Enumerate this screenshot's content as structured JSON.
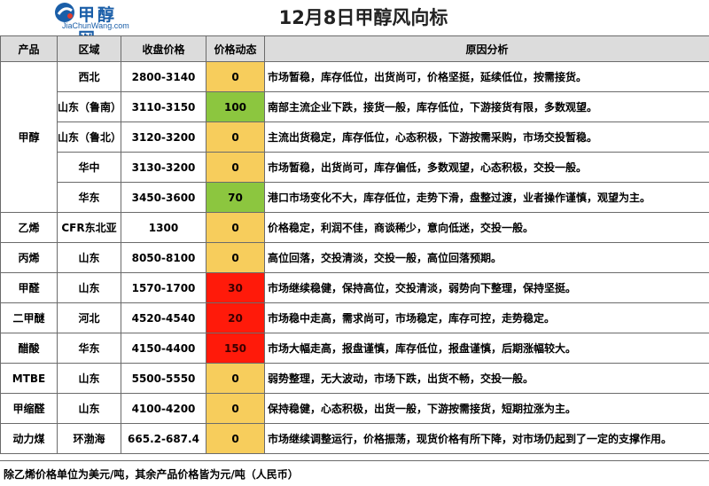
{
  "logo": {
    "cn": "甲醇网",
    "en": "JiaChunWang.com"
  },
  "title": "12月8日甲醇风向标",
  "headers": [
    "产品",
    "区域",
    "收盘价格",
    "价格动态",
    "原因分析"
  ],
  "rows": [
    {
      "product": "甲醇",
      "region": "西北",
      "price": "2800-3140",
      "change": "0",
      "reason": "市场暂稳，库存低位，出货尚可，价格坚挺，延续低位，按需接货。"
    },
    {
      "region": "山东（鲁南）",
      "price": "3110-3150",
      "change": "100",
      "reason": "南部主流企业下跌，接货一般，库存低位，下游接货有限，多数观望。"
    },
    {
      "region": "山东（鲁北）",
      "price": "3120-3200",
      "change": "0",
      "reason": "主流出货稳定，库存低位，心态积极，下游按需采购，市场交投暂稳。"
    },
    {
      "region": "华中",
      "price": "3130-3200",
      "change": "0",
      "reason": "市场暂稳，出货尚可，库存偏低，多数观望，心态积极，交投一般。"
    },
    {
      "region": "华东",
      "price": "3450-3600",
      "change": "70",
      "reason": "港口市场变化不大，库存低位，走势下滑，盘整过渡，业者操作谨慎，观望为主。"
    },
    {
      "product": "乙烯",
      "region": "CFR东北亚",
      "price": "1300",
      "change": "0",
      "reason": "价格稳定，利润不佳，商谈稀少，意向低迷，交投一般。"
    },
    {
      "product": "丙烯",
      "region": "山东",
      "price": "8050-8100",
      "change": "0",
      "reason": "高位回落，交投清淡，交投一般，高位回落预期。"
    },
    {
      "product": "甲醛",
      "region": "山东",
      "price": "1570-1700",
      "change": "30",
      "reason": "市场继续稳健，保持高位，交投清淡，弱势向下整理，保持坚挺。"
    },
    {
      "product": "二甲醚",
      "region": "河北",
      "price": "4520-4540",
      "change": "20",
      "reason": "市场稳中走高，需求尚可，市场稳定，库存可控，走势稳定。"
    },
    {
      "product": "醋酸",
      "region": "华东",
      "price": "4150-4400",
      "change": "150",
      "reason": "市场大幅走高，报盘谨慎，库存低位，报盘谨慎，后期涨幅较大。"
    },
    {
      "product": "MTBE",
      "region": "山东",
      "price": "5500-5550",
      "change": "0",
      "reason": "弱势整理，无大波动，市场下跌，出货不畅，交投一般。"
    },
    {
      "product": "甲缩醛",
      "region": "山东",
      "price": "4100-4200",
      "change": "0",
      "reason": "保持稳健，心态积极，出货一般，下游按需接货，短期拉涨为主。"
    },
    {
      "product": "动力煤",
      "region": "环渤海",
      "price": "665.2-687.4",
      "change": "0",
      "reason": "市场继续调整运行，价格振荡，现货价格有所下降，对市场仍起到了一定的支撑作用。"
    }
  ],
  "footer": "除乙烯价格单位为美元/吨，其余产品价格皆为元/吨（人民币）",
  "colors": {
    "yellow": "#f7cd5c",
    "green": "#8cc63f",
    "red": "#ff1a0a",
    "header_bg": "#dcdcdc",
    "logo_blue": "#1a5ea8"
  }
}
